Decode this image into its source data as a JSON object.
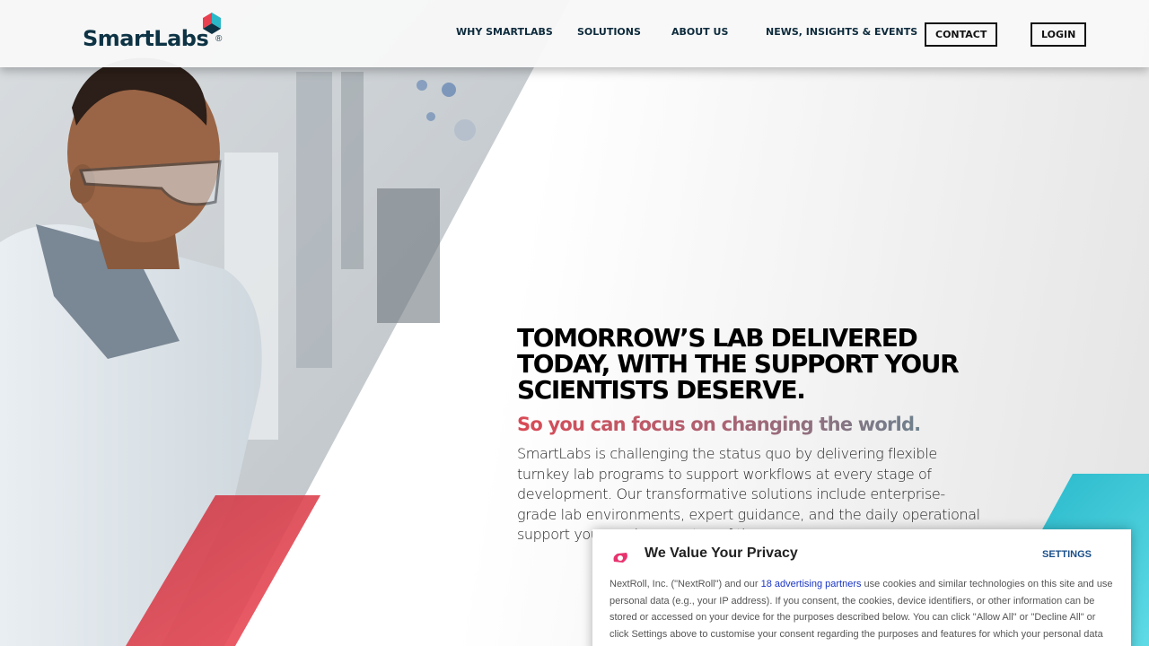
{
  "brand": {
    "name": "SmartLabs",
    "registered": "®"
  },
  "nav": {
    "items": [
      "WHY SMARTLABS",
      "SOLUTIONS",
      "ABOUT US",
      "NEWS, INSIGHTS & EVENTS"
    ],
    "contact": "CONTACT",
    "login": "LOGIN"
  },
  "hero": {
    "headline_1": "TOMORROW’S LAB DELIVERED",
    "headline_2": "TODAY, WITH THE SUPPORT YOUR",
    "headline_3": "SCIENTISTS DESERVE.",
    "subhead": "So you can focus on changing the world.",
    "body": "SmartLabs is challenging the status quo by delivering flexible turnkey lab programs to support workflows at every stage of development. Our transformative solutions include enterprise-grade lab environments, expert guidance, and the daily operational support you need every step of the way."
  },
  "privacy": {
    "title": "We Value Your Privacy",
    "settings": "SETTINGS",
    "text_before": "NextRoll, Inc. (\"NextRoll\") and our ",
    "partners_link": "18 advertising partners",
    "text_after": " use cookies and similar technologies on this site and use personal data (e.g., your IP address). If you consent, the cookies, device identifiers, or other information can be stored or accessed on your device for the purposes described below. You can click \"Allow All\" or \"Decline All\" or click Settings above to customise your consent regarding the purposes and features for which your personal data"
  },
  "colors": {
    "brand_navy": "#0d3344",
    "accent_red": "#e8404f",
    "accent_teal": "#2bb8c8"
  }
}
